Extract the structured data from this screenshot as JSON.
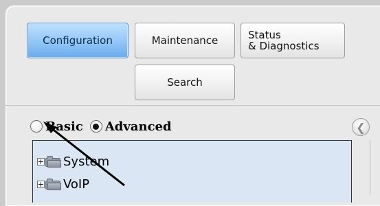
{
  "tabs": {
    "configuration": "Configuration",
    "maintenance": "Maintenance",
    "status_line1": "Status",
    "status_line2": "& Diagnostics",
    "search": "Search"
  },
  "view_mode": {
    "basic_label": "Basic",
    "advanced_label": "Advanced",
    "selected": "Advanced"
  },
  "tree": {
    "items": [
      {
        "label": "System",
        "expander": "+"
      },
      {
        "label": "VoIP",
        "expander": "+"
      }
    ]
  },
  "icons": {
    "collapse": "chevron-left-icon",
    "folder": "folder-icon",
    "expand": "plus-icon",
    "pointer": "arrow-pointer"
  },
  "colors": {
    "active_tab": "#92c6f7",
    "tree_background": "#dbe6f4",
    "panel_background": "#e9e9e9"
  }
}
